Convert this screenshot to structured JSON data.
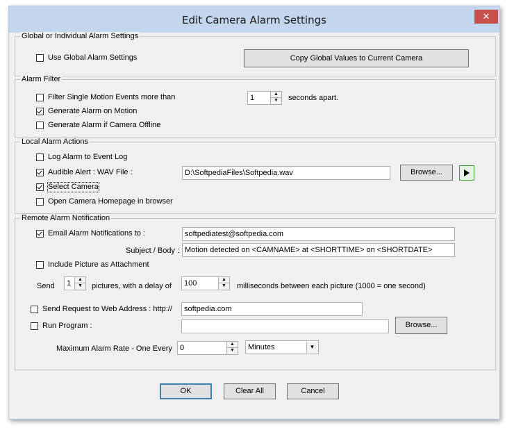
{
  "window": {
    "title": "Edit Camera Alarm Settings",
    "close_label": "✕"
  },
  "global_group": {
    "label": "Global or Individual Alarm Settings",
    "use_global": {
      "label": "Use Global Alarm Settings",
      "checked": false
    },
    "copy_button": "Copy Global Values to Current Camera"
  },
  "filter_group": {
    "label": "Alarm Filter",
    "filter_single": {
      "label": "Filter Single Motion Events more than",
      "checked": false
    },
    "seconds_value": "1",
    "seconds_suffix": "seconds apart.",
    "gen_motion": {
      "label": "Generate Alarm on Motion",
      "checked": true
    },
    "gen_offline": {
      "label": "Generate Alarm if Camera Offline",
      "checked": false
    }
  },
  "local_group": {
    "label": "Local Alarm Actions",
    "log_event": {
      "label": "Log Alarm to Event Log",
      "checked": false
    },
    "audible": {
      "label": "Audible Alert : WAV File :",
      "checked": true
    },
    "wav_path": "D:\\SoftpediaFiles\\Softpedia.wav",
    "browse_label": "Browse...",
    "select_camera": {
      "label": "Select Camera",
      "checked": true
    },
    "open_homepage": {
      "label": "Open Camera Homepage in browser",
      "checked": false
    }
  },
  "remote_group": {
    "label": "Remote  Alarm Notification",
    "email": {
      "label": "Email Alarm Notifications to :",
      "checked": true
    },
    "email_value": "softpediatest@softpedia.com",
    "subject_label": "Subject / Body :",
    "subject_value": "Motion detected on <CAMNAME> at <SHORTTIME> on <SHORTDATE>",
    "include_picture": {
      "label": "Include Picture as Attachment",
      "checked": false
    },
    "send_label": "Send",
    "pictures_value": "1",
    "pictures_label": "pictures, with a delay of",
    "delay_value": "100",
    "delay_label": "milliseconds between each picture (1000 = one second)",
    "web_request": {
      "label": "Send Request to Web Address : http://",
      "checked": false
    },
    "web_value": "softpedia.com",
    "run_program": {
      "label": "Run Program :",
      "checked": false
    },
    "program_value": "",
    "browse_label": "Browse...",
    "rate_label": "Maximum Alarm Rate - One Every",
    "rate_value": "0",
    "rate_unit": "Minutes"
  },
  "buttons": {
    "ok": "OK",
    "clear_all": "Clear All",
    "cancel": "Cancel"
  },
  "colors": {
    "titlebar": "#c3d6ee",
    "close": "#c7504a",
    "dialog_bg": "#f0f0f0",
    "play_border": "#3a9a3a"
  }
}
